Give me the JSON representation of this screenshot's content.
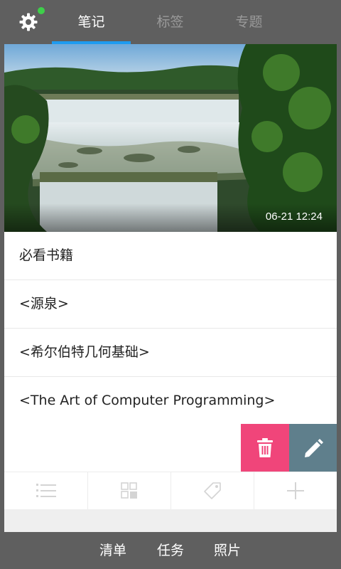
{
  "colors": {
    "header_bg": "#5f5f5f",
    "accent": "#1e9bf0",
    "status_dot": "#3ecf4a",
    "delete_bg": "#f0457a",
    "edit_bg": "#5f7f8c"
  },
  "header": {
    "settings_icon": "gear-icon",
    "tabs": [
      {
        "label": "笔记",
        "active": true
      },
      {
        "label": "标签",
        "active": false
      },
      {
        "label": "专题",
        "active": false
      }
    ]
  },
  "note": {
    "timestamp": "06-21 12:24",
    "items": [
      {
        "text": "必看书籍"
      },
      {
        "text": "<源泉>"
      },
      {
        "text": "<希尔伯特几何基础>"
      },
      {
        "text": "<The Art of Computer Programming>"
      }
    ],
    "actions": [
      {
        "icon": "trash-icon"
      },
      {
        "icon": "pencil-icon"
      }
    ]
  },
  "toolbar": {
    "tools": [
      {
        "icon": "numbered-list-icon"
      },
      {
        "icon": "grid-icon"
      },
      {
        "icon": "tag-icon"
      },
      {
        "icon": "plus-icon"
      }
    ]
  },
  "bottom_nav": {
    "items": [
      {
        "label": "清单"
      },
      {
        "label": "任务"
      },
      {
        "label": "照片"
      }
    ]
  }
}
